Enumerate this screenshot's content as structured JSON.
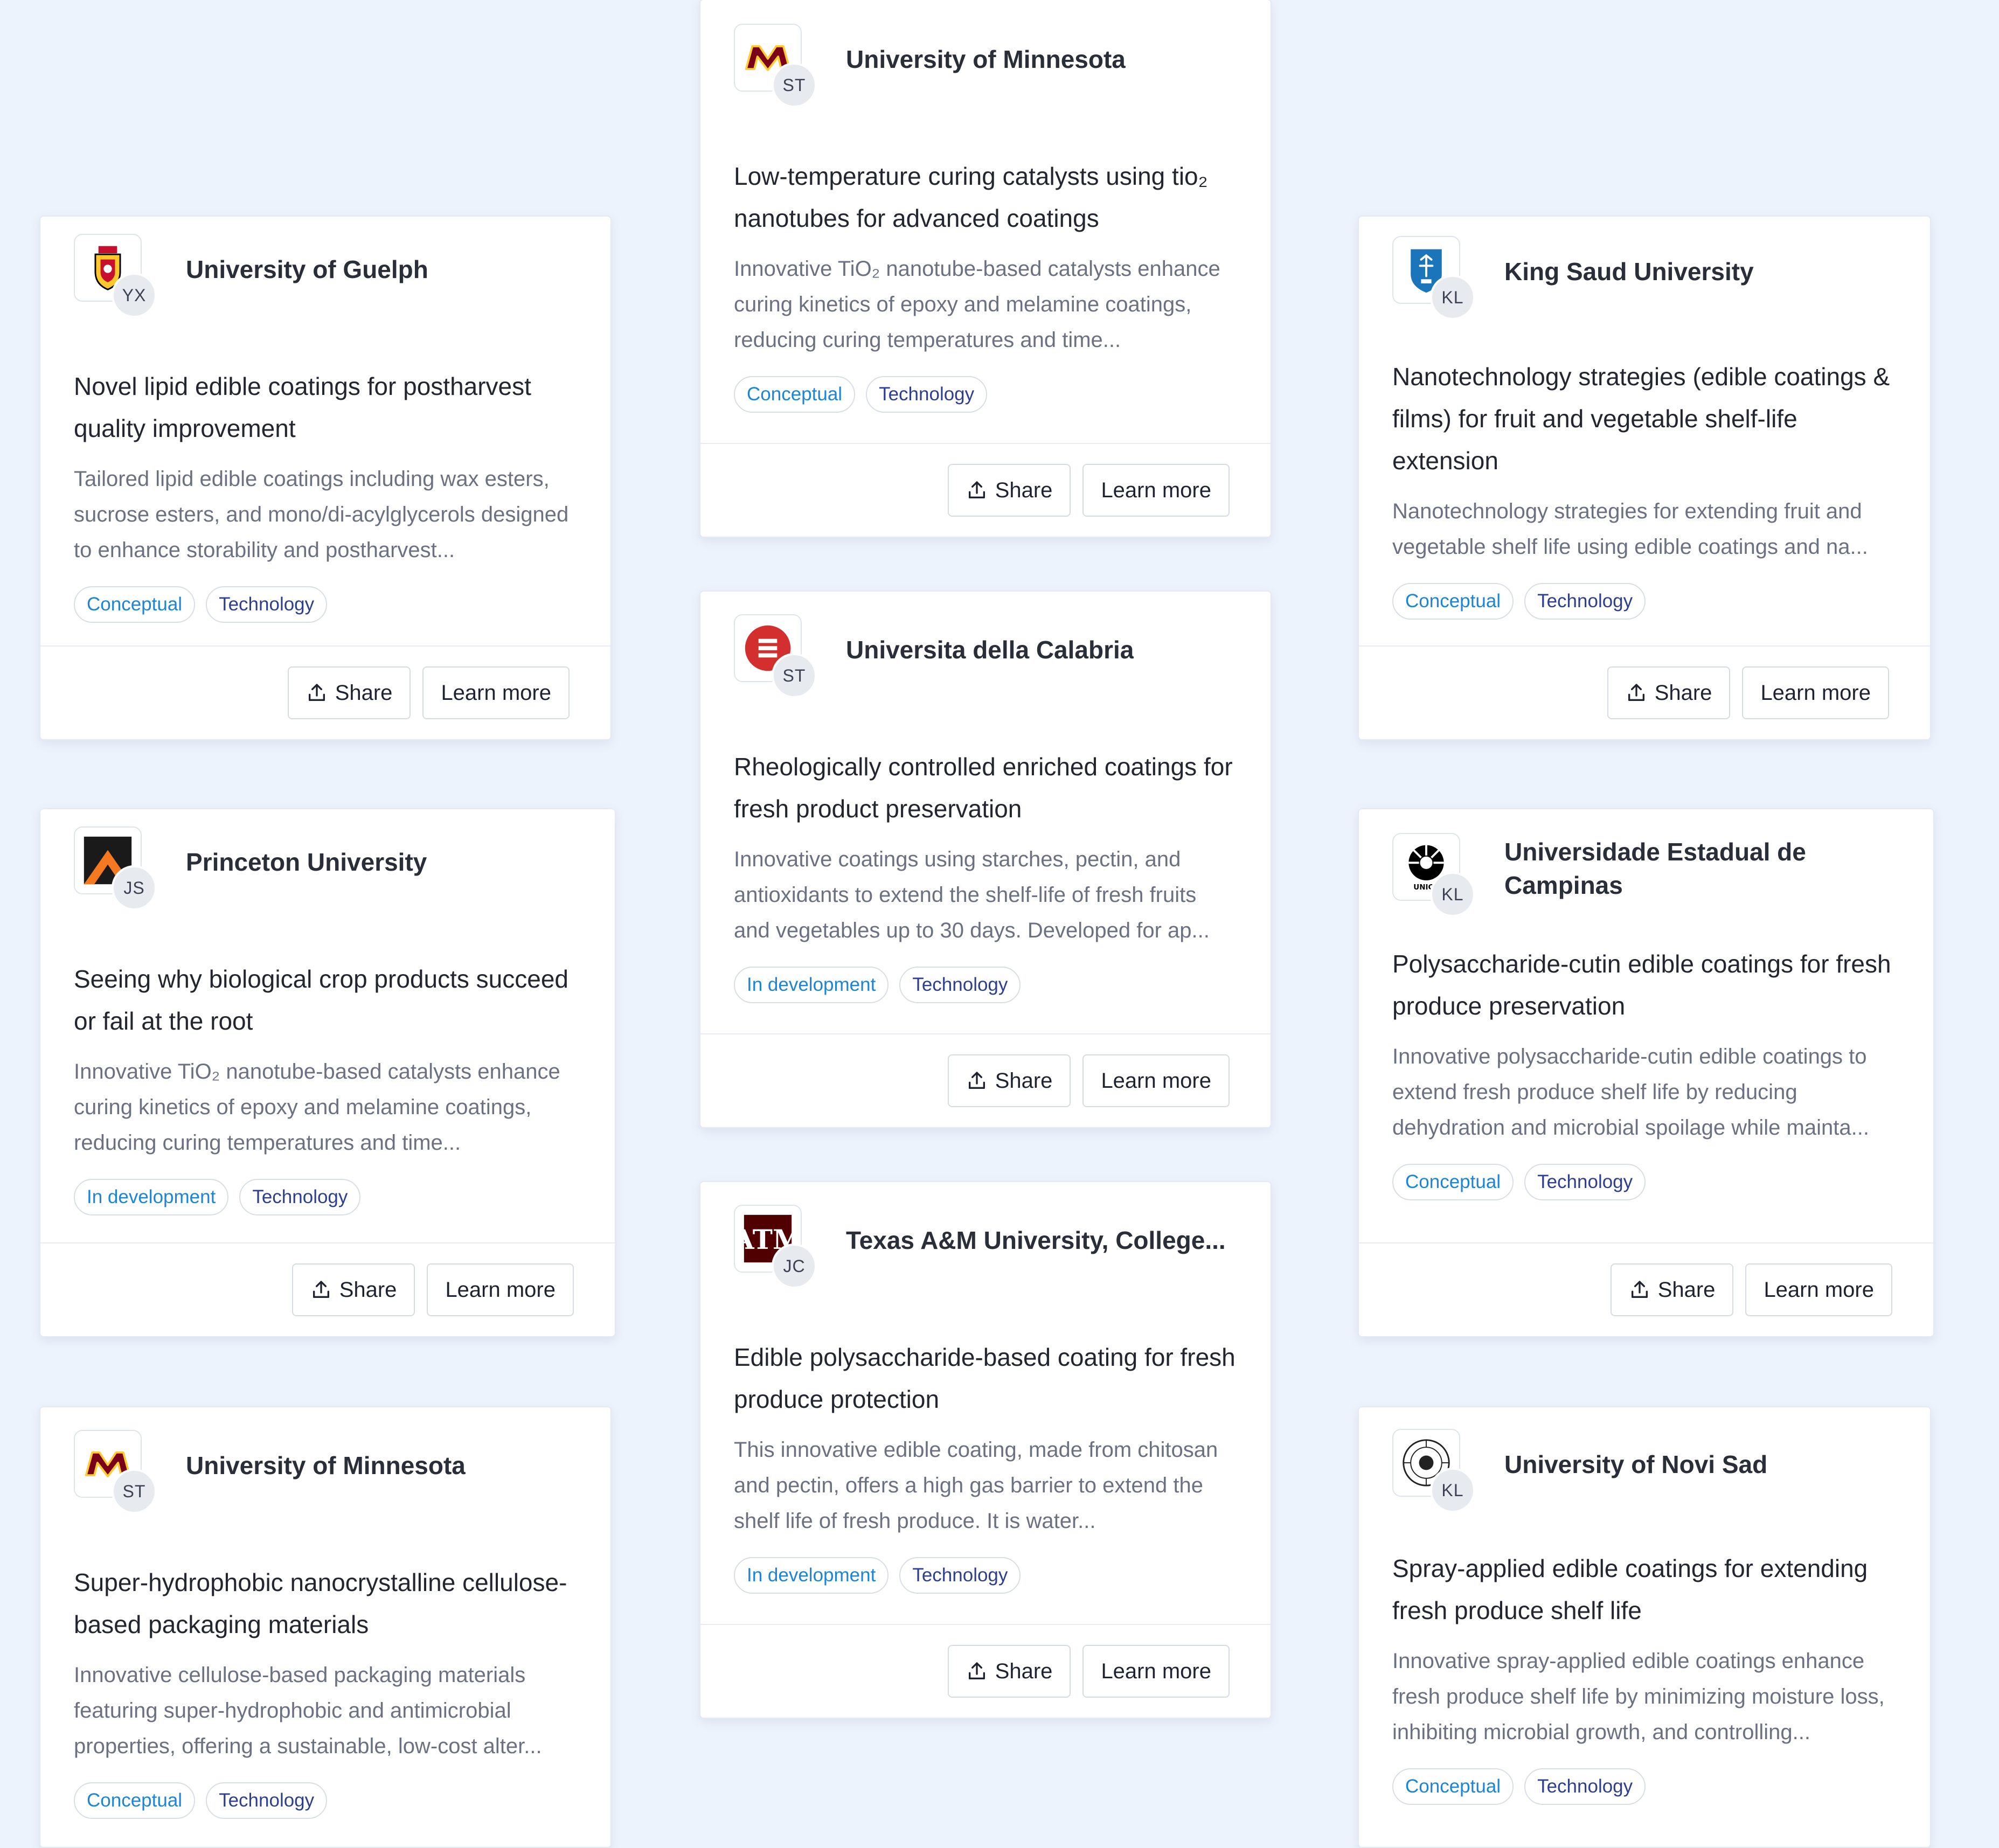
{
  "cards": [
    {
      "university": "University of Minnesota",
      "initials": "ST",
      "logo_icon": "minnesota-m-logo",
      "title": "Low-temperature curing catalysts using tio₂ nanotubes for advanced coatings",
      "description": "Innovative TiO₂ nanotube-based catalysts enhance curing kinetics of epoxy and melamine coatings, reducing curing temperatures and time...",
      "status_tag": "Conceptual",
      "type_tag": "Technology",
      "share_label": "Share",
      "learn_more_label": "Learn more"
    },
    {
      "university": "University of Guelph",
      "initials": "YX",
      "logo_icon": "guelph-crest-logo",
      "title": "Novel lipid edible coatings for postharvest quality improvement",
      "description": "Tailored lipid edible coatings including wax esters, sucrose esters, and mono/di-acylglycerols designed to enhance storability and postharvest...",
      "status_tag": "Conceptual",
      "type_tag": "Technology",
      "share_label": "Share",
      "learn_more_label": "Learn more"
    },
    {
      "university": "King Saud University",
      "initials": "KL",
      "logo_icon": "king-saud-shield-logo",
      "title": "Nanotechnology strategies (edible coatings & films) for fruit and vegetable shelf-life extension",
      "description": "Nanotechnology strategies for extending fruit and vegetable shelf life using edible coatings and na...",
      "status_tag": "Conceptual",
      "type_tag": "Technology",
      "share_label": "Share",
      "learn_more_label": "Learn more"
    },
    {
      "university": "Universita della Calabria",
      "initials": "ST",
      "logo_icon": "calabria-logo",
      "title": "Rheologically controlled enriched coatings for fresh product preservation",
      "description": "Innovative coatings using starches, pectin, and antioxidants to extend the shelf-life of fresh fruits and vegetables up to 30 days. Developed for ap...",
      "status_tag": "In development",
      "type_tag": "Technology",
      "share_label": "Share",
      "learn_more_label": "Learn more"
    },
    {
      "university": "Princeton University",
      "initials": "JS",
      "logo_icon": "princeton-logo",
      "title": "Seeing why biological crop products succeed or fail at the root",
      "description": "Innovative TiO₂ nanotube-based catalysts enhance curing kinetics of epoxy and melamine coatings, reducing curing temperatures and time...",
      "status_tag": "In development",
      "type_tag": "Technology",
      "share_label": "Share",
      "learn_more_label": "Learn more"
    },
    {
      "university": "Universidade Estadual de Campinas",
      "initials": "KL",
      "logo_icon": "unicamp-logo",
      "title": "Polysaccharide-cutin edible coatings for fresh produce preservation",
      "description": "Innovative polysaccharide-cutin edible coatings to extend fresh produce shelf life by reducing dehydration and microbial spoilage while mainta...",
      "status_tag": "Conceptual",
      "type_tag": "Technology",
      "share_label": "Share",
      "learn_more_label": "Learn more"
    },
    {
      "university": "Texas A&M University, College...",
      "initials": "JC",
      "logo_icon": "texas-am-logo",
      "title": "Edible polysaccharide-based coating for fresh produce protection",
      "description": "This innovative edible coating, made from chitosan and pectin, offers a high gas barrier to extend the shelf life of fresh produce. It is water...",
      "status_tag": "In development",
      "type_tag": "Technology",
      "share_label": "Share",
      "learn_more_label": "Learn more"
    },
    {
      "university": "University of Minnesota",
      "initials": "ST",
      "logo_icon": "minnesota-m-logo",
      "title": "Super-hydrophobic nanocrystalline cellulose-based packaging materials",
      "description": "Innovative cellulose-based packaging materials featuring super-hydrophobic and antimicrobial properties, offering a sustainable, low-cost alter...",
      "status_tag": "Conceptual",
      "type_tag": "Technology",
      "share_label": "Share",
      "learn_more_label": "Learn more"
    },
    {
      "university": "University of Novi Sad",
      "initials": "KL",
      "logo_icon": "novi-sad-seal-logo",
      "title": "Spray-applied edible coatings for extending fresh produce shelf life",
      "description": "Innovative spray-applied edible coatings enhance fresh produce shelf life by minimizing moisture loss, inhibiting microbial growth, and controlling...",
      "status_tag": "Conceptual",
      "type_tag": "Technology",
      "share_label": "Share",
      "learn_more_label": "Learn more"
    }
  ]
}
